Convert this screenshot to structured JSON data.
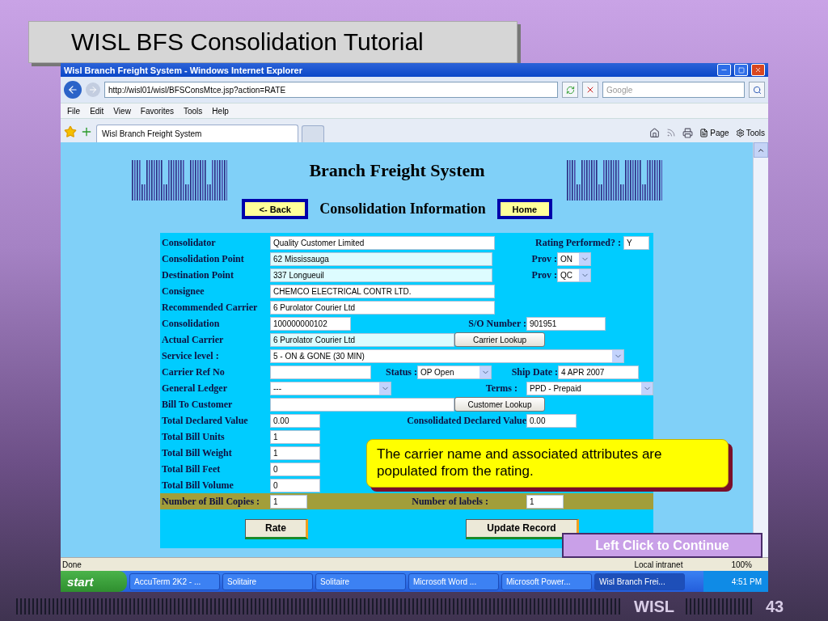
{
  "slide": {
    "title": "WISL BFS Consolidation Tutorial",
    "footer_brand": "WISL",
    "page_number": "43"
  },
  "browser": {
    "title": "Wisl Branch Freight System - Windows Internet Explorer",
    "address": "http://wisl01/wisl/BFSConsMtce.jsp?action=RATE",
    "search_placeholder": "Google",
    "menu": [
      "File",
      "Edit",
      "View",
      "Favorites",
      "Tools",
      "Help"
    ],
    "tabs": [
      {
        "label": "Wisl Branch Freight System",
        "selected": true
      }
    ],
    "command_menus": [
      "Page",
      "Tools"
    ],
    "status": "Done",
    "zone": "Local intranet",
    "zoom": "100%"
  },
  "page": {
    "heading": "Branch Freight System",
    "subheading": "Consolidation Information",
    "nav_buttons": [
      "<- Back",
      "Home"
    ],
    "rows": [
      {
        "label": "Consolidator",
        "controls": [
          {
            "kind": "text",
            "value": "Quality Customer Limited",
            "readonly": false
          },
          {
            "kind": "caption",
            "text": "Rating Performed? :"
          },
          {
            "kind": "text",
            "value": "Y",
            "readonly": false
          }
        ]
      },
      {
        "label": "Consolidation Point",
        "controls": [
          {
            "kind": "text",
            "value": "62 Mississauga",
            "readonly": true
          },
          {
            "kind": "caption",
            "text": "Prov :"
          },
          {
            "kind": "select",
            "value": "ON"
          }
        ]
      },
      {
        "label": "Destination Point",
        "controls": [
          {
            "kind": "text",
            "value": "337 Longueuil",
            "readonly": true
          },
          {
            "kind": "caption",
            "text": "Prov :"
          },
          {
            "kind": "select",
            "value": "QC"
          }
        ]
      },
      {
        "label": "Consignee",
        "controls": [
          {
            "kind": "text",
            "value": "CHEMCO ELECTRICAL CONTR LTD.",
            "readonly": false
          }
        ]
      },
      {
        "label": "Recommended Carrier",
        "controls": [
          {
            "kind": "text",
            "value": "6 Purolator Courier Ltd",
            "readonly": false
          }
        ]
      },
      {
        "label": "Consolidation",
        "controls": [
          {
            "kind": "text",
            "value": "100000000102",
            "readonly": false
          },
          {
            "kind": "caption",
            "text": "S/O Number :"
          },
          {
            "kind": "text",
            "value": "901951",
            "readonly": false
          }
        ]
      },
      {
        "label": "Actual Carrier",
        "controls": [
          {
            "kind": "text",
            "value": "6 Purolator Courier Ltd",
            "readonly": true
          },
          {
            "kind": "button",
            "label": "Carrier Lookup"
          }
        ]
      },
      {
        "label": "Service level :",
        "controls": [
          {
            "kind": "select",
            "value": "5 - ON & GONE (30 MIN)"
          }
        ]
      },
      {
        "label": "Carrier Ref No",
        "controls": [
          {
            "kind": "text",
            "readonly": false
          },
          {
            "kind": "caption",
            "text": "Status :"
          },
          {
            "kind": "select",
            "value": "OP Open"
          },
          {
            "kind": "caption",
            "text": "Ship Date :"
          },
          {
            "kind": "text",
            "value": "4 APR 2007",
            "readonly": false
          }
        ]
      },
      {
        "label": "General Ledger",
        "controls": [
          {
            "kind": "select",
            "value": "---"
          },
          {
            "kind": "caption",
            "text": "Terms :"
          },
          {
            "kind": "select",
            "value": "PPD - Prepaid"
          }
        ]
      },
      {
        "label": "Bill To Customer",
        "controls": [
          {
            "kind": "text",
            "readonly": false
          },
          {
            "kind": "button",
            "label": "Customer Lookup"
          }
        ]
      },
      {
        "label": "Total Declared Value",
        "controls": [
          {
            "kind": "text",
            "value": "0.00",
            "readonly": false
          },
          {
            "kind": "caption",
            "text": "Consolidated Declared Value"
          },
          {
            "kind": "text",
            "value": "0.00",
            "readonly": false
          }
        ]
      },
      {
        "label": "Total Bill Units",
        "controls": [
          {
            "kind": "text",
            "value": "1",
            "readonly": false
          }
        ]
      },
      {
        "label": "Total Bill Weight",
        "controls": [
          {
            "kind": "text",
            "value": "1",
            "readonly": false
          }
        ]
      },
      {
        "label": "Total Bill Feet",
        "controls": [
          {
            "kind": "text",
            "value": "0",
            "readonly": false
          }
        ]
      },
      {
        "label": "Total Bill Volume",
        "controls": [
          {
            "kind": "text",
            "value": "0",
            "readonly": false
          }
        ]
      },
      {
        "label": "Number of Bill Copies :",
        "highlighted": true,
        "controls": [
          {
            "kind": "text",
            "value": "1",
            "readonly": false
          },
          {
            "kind": "caption",
            "text": "Number of labels :"
          },
          {
            "kind": "text",
            "value": "1",
            "readonly": false
          }
        ]
      }
    ],
    "actions": [
      "Rate",
      "Update Record"
    ]
  },
  "callout": {
    "text": "The carrier name and associated attributes are populated from the rating."
  },
  "continue_button": "Left Click to Continue",
  "taskbar": {
    "start": "start",
    "items": [
      {
        "label": "AccuTerm 2K2 - ...",
        "selected": false
      },
      {
        "label": "Solitaire",
        "selected": false
      },
      {
        "label": "Solitaire",
        "selected": false
      },
      {
        "label": "Microsoft Word ...",
        "selected": false
      },
      {
        "label": "Microsoft Power...",
        "selected": false
      },
      {
        "label": "Wisl Branch Frei...",
        "selected": true
      }
    ],
    "clock": "4:51 PM"
  }
}
